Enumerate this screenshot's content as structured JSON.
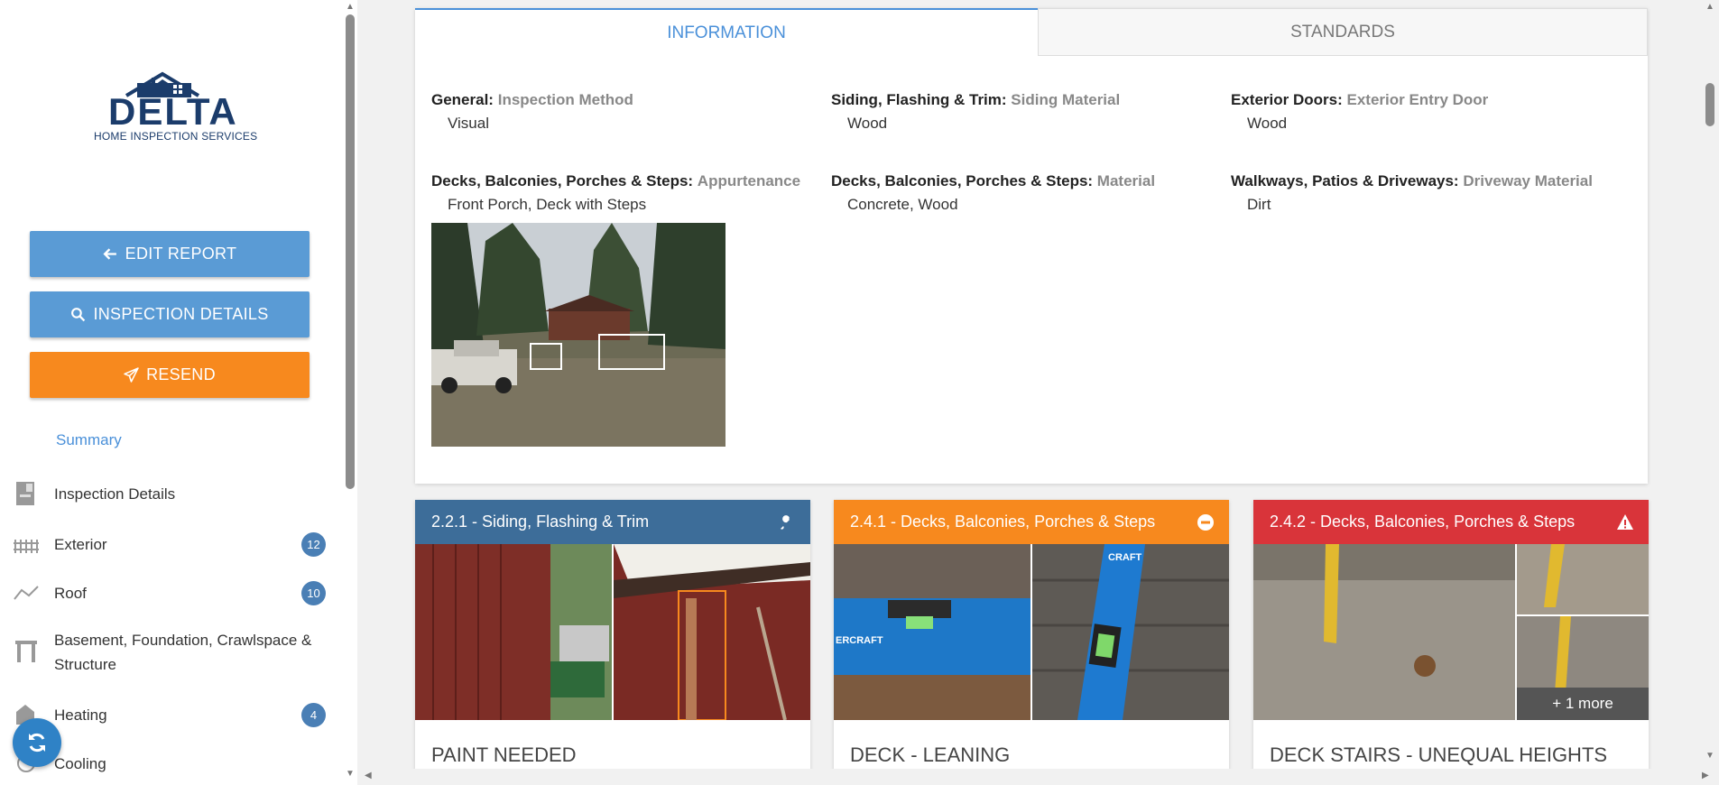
{
  "logo": {
    "word": "DELTA",
    "subtitle": "HOME INSPECTION SERVICES"
  },
  "buttons": {
    "edit_report": "EDIT REPORT",
    "inspection_details": "INSPECTION DETAILS",
    "resend": "RESEND"
  },
  "sidebar": {
    "summary": "Summary",
    "items": [
      {
        "label": "Inspection Details",
        "icon": "clipboard-icon",
        "badge": ""
      },
      {
        "label": "Exterior",
        "icon": "fence-icon",
        "badge": "12"
      },
      {
        "label": "Roof",
        "icon": "roof-icon",
        "badge": "10"
      },
      {
        "label": "Basement, Foundation, Crawlspace & Structure",
        "icon": "foundation-icon",
        "badge": ""
      },
      {
        "label": "Heating",
        "icon": "heating-icon",
        "badge": "4"
      },
      {
        "label": "Cooling",
        "icon": "cooling-icon",
        "badge": ""
      }
    ]
  },
  "tabs": {
    "information": "INFORMATION",
    "standards": "STANDARDS"
  },
  "info_fields": [
    {
      "section": "General:",
      "name": "Inspection Method",
      "value": "Visual"
    },
    {
      "section": "Siding, Flashing & Trim:",
      "name": "Siding Material",
      "value": "Wood"
    },
    {
      "section": "Exterior Doors:",
      "name": "Exterior Entry Door",
      "value": "Wood"
    },
    {
      "section": "Decks, Balconies, Porches & Steps:",
      "name": "Appurtenance",
      "value": "Front Porch, Deck with Steps"
    },
    {
      "section": "Decks, Balconies, Porches & Steps:",
      "name": "Material",
      "value": "Concrete, Wood"
    },
    {
      "section": "Walkways, Patios & Driveways:",
      "name": "Driveway Material",
      "value": "Dirt"
    }
  ],
  "defects": [
    {
      "header": "2.2.1 - Siding, Flashing & Trim",
      "title": "PAINT NEEDED",
      "color": "#3d6d99",
      "icon": "wrench-icon"
    },
    {
      "header": "2.4.1 - Decks, Balconies, Porches & Steps",
      "title": "DECK - LEANING",
      "color": "#f7891e",
      "icon": "minus-circle-icon"
    },
    {
      "header": "2.4.2 - Decks, Balconies, Porches & Steps",
      "title": "DECK STAIRS - UNEQUAL HEIGHTS",
      "color": "#d9343a",
      "icon": "warning-icon",
      "more": "+ 1 more"
    }
  ],
  "photo_text": {
    "level_brand_a": "ERCRAFT",
    "level_brand_b": "CRAFT"
  }
}
